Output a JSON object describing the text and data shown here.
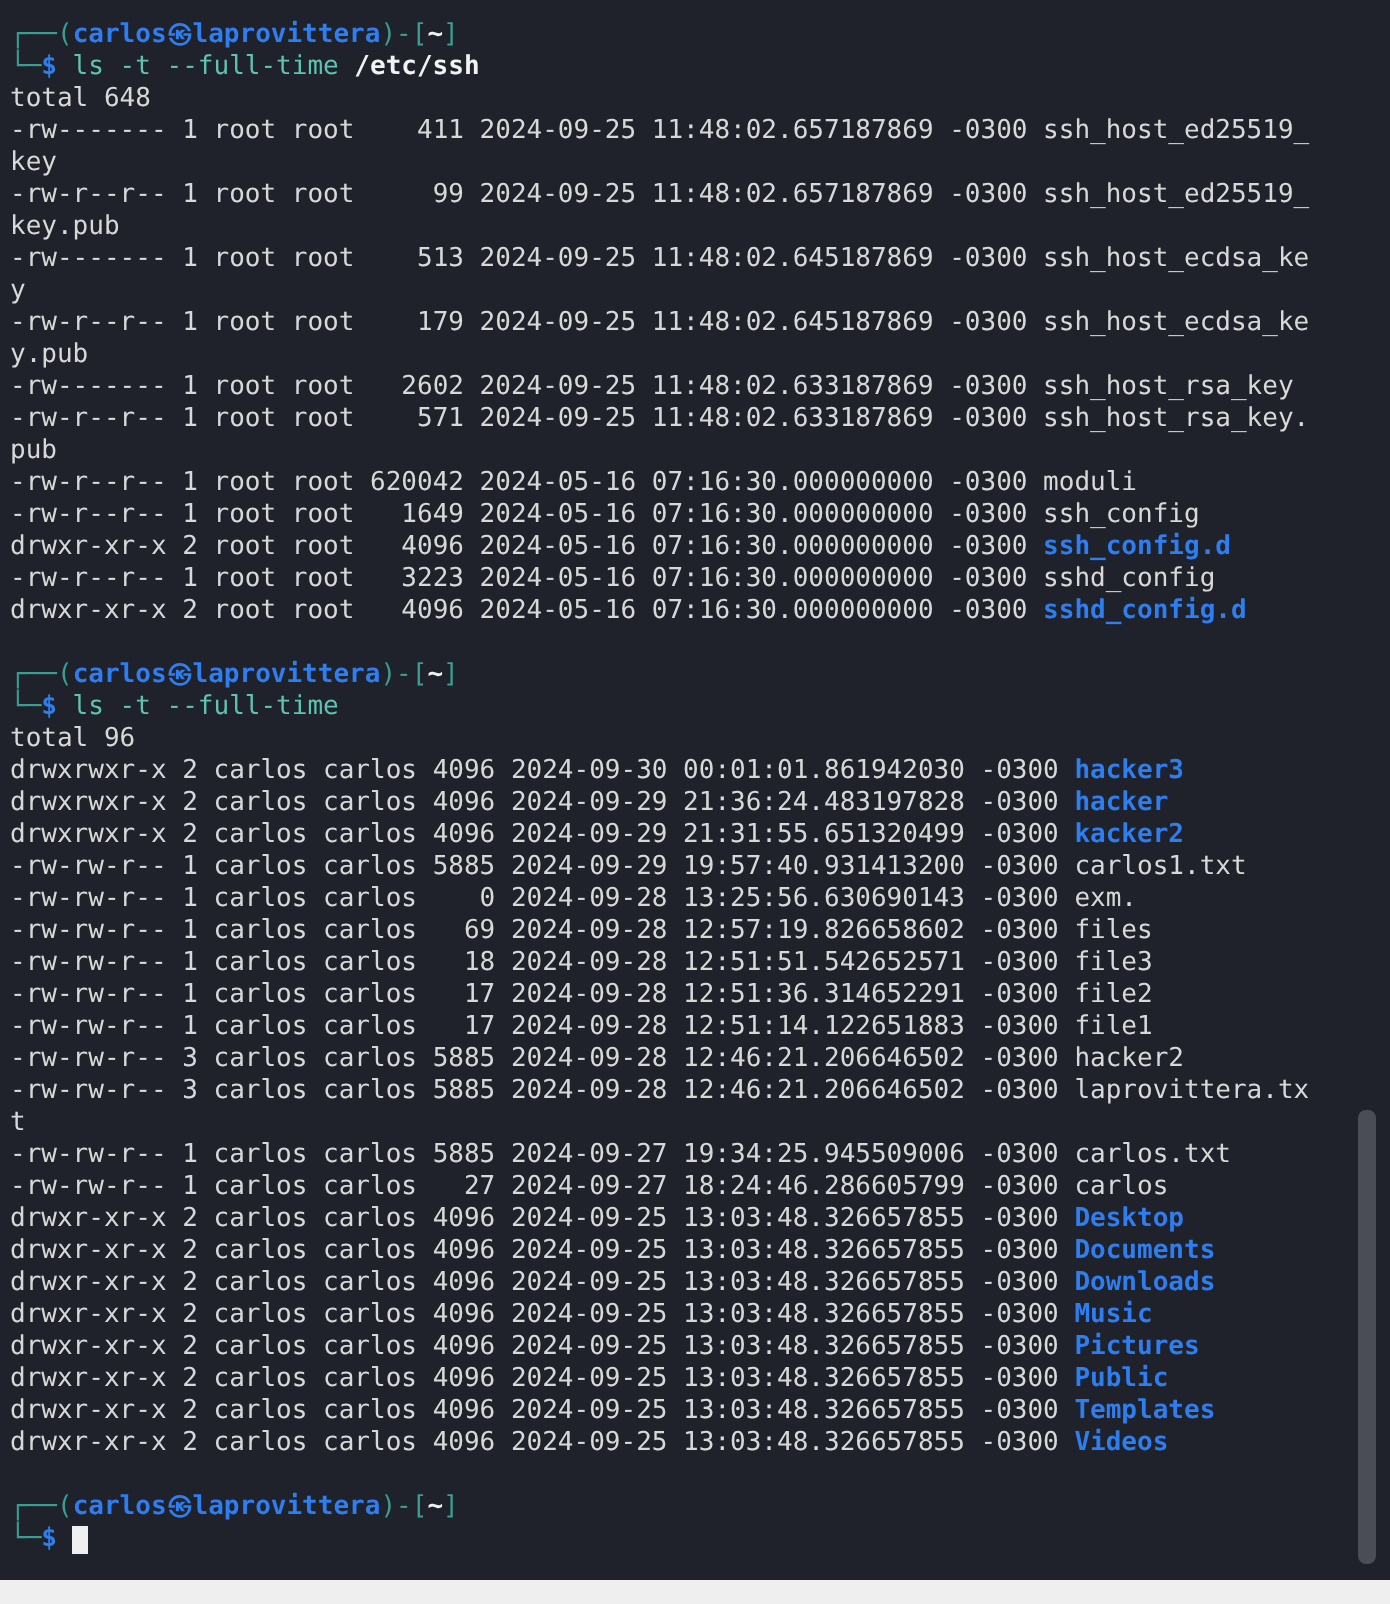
{
  "terminal": {
    "lines": [
      {
        "kind": "prompt",
        "corner": "┌──(",
        "user_host": "carlos㉿laprovittera",
        "separator": ")-[",
        "cwd": "~",
        "close": "]"
      },
      {
        "kind": "command",
        "corner": "└─",
        "sign": "$",
        "command": "ls -t --full-time",
        "argument": "/etc/ssh"
      },
      {
        "kind": "text",
        "text": "total 648"
      },
      {
        "kind": "entry",
        "info": "-rw------- 1 root root    411 2024-09-25 11:48:02.657187869 -0300",
        "name": "ssh_host_ed25519_",
        "directory": false
      },
      {
        "kind": "text",
        "text": "key"
      },
      {
        "kind": "entry",
        "info": "-rw-r--r-- 1 root root     99 2024-09-25 11:48:02.657187869 -0300",
        "name": "ssh_host_ed25519_",
        "directory": false
      },
      {
        "kind": "text",
        "text": "key.pub"
      },
      {
        "kind": "entry",
        "info": "-rw------- 1 root root    513 2024-09-25 11:48:02.645187869 -0300",
        "name": "ssh_host_ecdsa_ke",
        "directory": false
      },
      {
        "kind": "text",
        "text": "y"
      },
      {
        "kind": "entry",
        "info": "-rw-r--r-- 1 root root    179 2024-09-25 11:48:02.645187869 -0300",
        "name": "ssh_host_ecdsa_ke",
        "directory": false
      },
      {
        "kind": "text",
        "text": "y.pub"
      },
      {
        "kind": "entry",
        "info": "-rw------- 1 root root   2602 2024-09-25 11:48:02.633187869 -0300",
        "name": "ssh_host_rsa_key",
        "directory": false
      },
      {
        "kind": "entry",
        "info": "-rw-r--r-- 1 root root    571 2024-09-25 11:48:02.633187869 -0300",
        "name": "ssh_host_rsa_key.",
        "directory": false
      },
      {
        "kind": "text",
        "text": "pub"
      },
      {
        "kind": "entry",
        "info": "-rw-r--r-- 1 root root 620042 2024-05-16 07:16:30.000000000 -0300",
        "name": "moduli",
        "directory": false
      },
      {
        "kind": "entry",
        "info": "-rw-r--r-- 1 root root   1649 2024-05-16 07:16:30.000000000 -0300",
        "name": "ssh_config",
        "directory": false
      },
      {
        "kind": "entry",
        "info": "drwxr-xr-x 2 root root   4096 2024-05-16 07:16:30.000000000 -0300",
        "name": "ssh_config.d",
        "directory": true
      },
      {
        "kind": "entry",
        "info": "-rw-r--r-- 1 root root   3223 2024-05-16 07:16:30.000000000 -0300",
        "name": "sshd_config",
        "directory": false
      },
      {
        "kind": "entry",
        "info": "drwxr-xr-x 2 root root   4096 2024-05-16 07:16:30.000000000 -0300",
        "name": "sshd_config.d",
        "directory": true
      },
      {
        "kind": "blank"
      },
      {
        "kind": "prompt",
        "corner": "┌──(",
        "user_host": "carlos㉿laprovittera",
        "separator": ")-[",
        "cwd": "~",
        "close": "]"
      },
      {
        "kind": "command",
        "corner": "└─",
        "sign": "$",
        "command": "ls -t --full-time"
      },
      {
        "kind": "text",
        "text": "total 96"
      },
      {
        "kind": "entry",
        "info": "drwxrwxr-x 2 carlos carlos 4096 2024-09-30 00:01:01.861942030 -0300",
        "name": "hacker3",
        "directory": true
      },
      {
        "kind": "entry",
        "info": "drwxrwxr-x 2 carlos carlos 4096 2024-09-29 21:36:24.483197828 -0300",
        "name": "hacker",
        "directory": true
      },
      {
        "kind": "entry",
        "info": "drwxrwxr-x 2 carlos carlos 4096 2024-09-29 21:31:55.651320499 -0300",
        "name": "kacker2",
        "directory": true
      },
      {
        "kind": "entry",
        "info": "-rw-rw-r-- 1 carlos carlos 5885 2024-09-29 19:57:40.931413200 -0300",
        "name": "carlos1.txt",
        "directory": false
      },
      {
        "kind": "entry",
        "info": "-rw-rw-r-- 1 carlos carlos    0 2024-09-28 13:25:56.630690143 -0300",
        "name": "exm.",
        "directory": false
      },
      {
        "kind": "entry",
        "info": "-rw-rw-r-- 1 carlos carlos   69 2024-09-28 12:57:19.826658602 -0300",
        "name": "files",
        "directory": false
      },
      {
        "kind": "entry",
        "info": "-rw-rw-r-- 1 carlos carlos   18 2024-09-28 12:51:51.542652571 -0300",
        "name": "file3",
        "directory": false
      },
      {
        "kind": "entry",
        "info": "-rw-rw-r-- 1 carlos carlos   17 2024-09-28 12:51:36.314652291 -0300",
        "name": "file2",
        "directory": false
      },
      {
        "kind": "entry",
        "info": "-rw-rw-r-- 1 carlos carlos   17 2024-09-28 12:51:14.122651883 -0300",
        "name": "file1",
        "directory": false
      },
      {
        "kind": "entry",
        "info": "-rw-rw-r-- 3 carlos carlos 5885 2024-09-28 12:46:21.206646502 -0300",
        "name": "hacker2",
        "directory": false
      },
      {
        "kind": "entry",
        "info": "-rw-rw-r-- 3 carlos carlos 5885 2024-09-28 12:46:21.206646502 -0300",
        "name": "laprovittera.tx",
        "directory": false
      },
      {
        "kind": "text",
        "text": "t"
      },
      {
        "kind": "entry",
        "info": "-rw-rw-r-- 1 carlos carlos 5885 2024-09-27 19:34:25.945509006 -0300",
        "name": "carlos.txt",
        "directory": false
      },
      {
        "kind": "entry",
        "info": "-rw-rw-r-- 1 carlos carlos   27 2024-09-27 18:24:46.286605799 -0300",
        "name": "carlos",
        "directory": false
      },
      {
        "kind": "entry",
        "info": "drwxr-xr-x 2 carlos carlos 4096 2024-09-25 13:03:48.326657855 -0300",
        "name": "Desktop",
        "directory": true
      },
      {
        "kind": "entry",
        "info": "drwxr-xr-x 2 carlos carlos 4096 2024-09-25 13:03:48.326657855 -0300",
        "name": "Documents",
        "directory": true
      },
      {
        "kind": "entry",
        "info": "drwxr-xr-x 2 carlos carlos 4096 2024-09-25 13:03:48.326657855 -0300",
        "name": "Downloads",
        "directory": true
      },
      {
        "kind": "entry",
        "info": "drwxr-xr-x 2 carlos carlos 4096 2024-09-25 13:03:48.326657855 -0300",
        "name": "Music",
        "directory": true
      },
      {
        "kind": "entry",
        "info": "drwxr-xr-x 2 carlos carlos 4096 2024-09-25 13:03:48.326657855 -0300",
        "name": "Pictures",
        "directory": true
      },
      {
        "kind": "entry",
        "info": "drwxr-xr-x 2 carlos carlos 4096 2024-09-25 13:03:48.326657855 -0300",
        "name": "Public",
        "directory": true
      },
      {
        "kind": "entry",
        "info": "drwxr-xr-x 2 carlos carlos 4096 2024-09-25 13:03:48.326657855 -0300",
        "name": "Templates",
        "directory": true
      },
      {
        "kind": "entry",
        "info": "drwxr-xr-x 2 carlos carlos 4096 2024-09-25 13:03:48.326657855 -0300",
        "name": "Videos",
        "directory": true
      },
      {
        "kind": "blank"
      },
      {
        "kind": "prompt",
        "corner": "┌──(",
        "user_host": "carlos㉿laprovittera",
        "separator": ")-[",
        "cwd": "~",
        "close": "]"
      },
      {
        "kind": "command",
        "corner": "└─",
        "sign": "$",
        "cursor": true
      }
    ]
  }
}
